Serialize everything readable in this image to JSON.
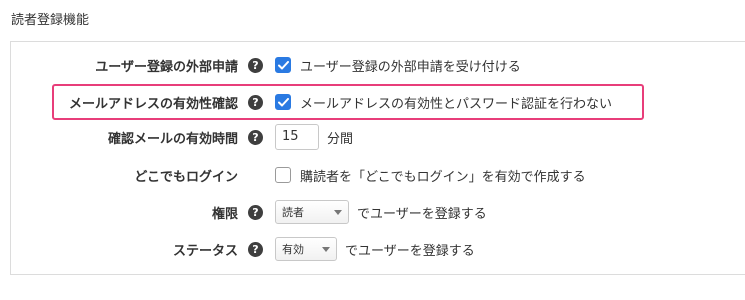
{
  "section": {
    "title": "読者登録機能"
  },
  "settings": [
    {
      "label": "ユーザー登録の外部申請",
      "control": "checkbox",
      "checked": true,
      "text": "ユーザー登録の外部申請を受け付ける"
    },
    {
      "label": "メールアドレスの有効性確認",
      "control": "checkbox",
      "checked": true,
      "text": "メールアドレスの有効性とパスワード認証を行わない",
      "highlighted": true
    },
    {
      "label": "確認メールの有効時間",
      "control": "number",
      "value": "15",
      "suffix": "分間"
    },
    {
      "label": "どこでもログイン",
      "control": "checkbox",
      "checked": false,
      "text": "購読者を「どこでもログイン」を有効で作成する"
    },
    {
      "label": "権限",
      "control": "select",
      "selected": "読者",
      "suffix": "でユーザーを登録する"
    },
    {
      "label": "ステータス",
      "control": "select",
      "selected": "有効",
      "suffix": "でユーザーを登録する"
    }
  ],
  "help_icon": {
    "name": "help-icon",
    "glyph": "?"
  },
  "colors": {
    "checkbox": "#2a7ae2",
    "highlight": "#e83e7a",
    "help": "#3f3f3f"
  }
}
